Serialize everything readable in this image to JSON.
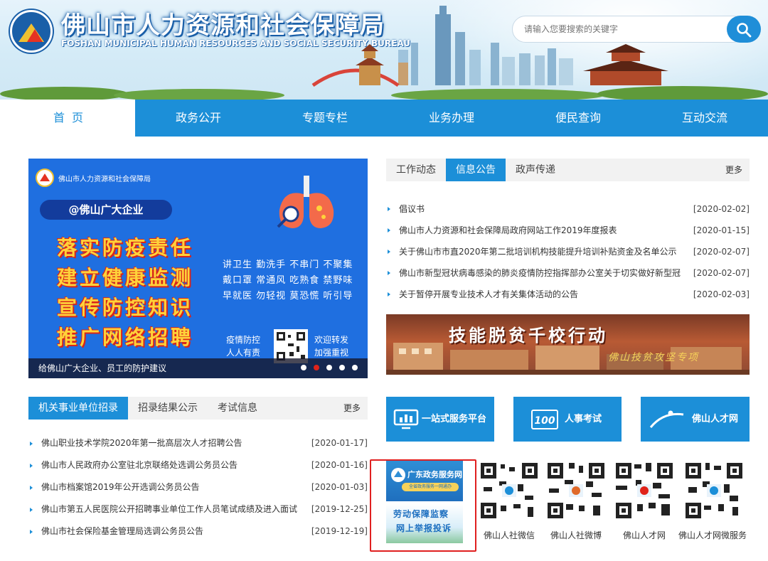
{
  "header": {
    "title_cn": "佛山市人力资源和社会保障局",
    "title_en": "FOSHAN MUNICIPAL HUMAN RESOURCES AND SOCIAL SECURITY BUREAU",
    "search_placeholder": "请输入您要搜索的关键字"
  },
  "nav": [
    {
      "label": "首页"
    },
    {
      "label": "政务公开"
    },
    {
      "label": "专题专栏"
    },
    {
      "label": "业务办理"
    },
    {
      "label": "便民查询"
    },
    {
      "label": "互动交流"
    }
  ],
  "banner": {
    "org": "佛山市人力资源和社会保障局",
    "pill": "@佛山广大企业",
    "lines": [
      "落实防疫责任",
      "建立健康监测",
      "宣传防控知识",
      "推广网络招聘"
    ],
    "side": [
      "讲卫生 勤洗手 不串门 不聚集",
      "戴口罩 常通风 吃熟食 禁野味",
      "早就医 勿轻视 莫恐慌 听引导"
    ],
    "slogan_left": [
      "疫情防控",
      "人人有责"
    ],
    "slogan_right": [
      "欢迎转发",
      "加强重视"
    ],
    "caption": "给佛山广大企业、员工的防护建议"
  },
  "news": {
    "tabs": [
      "工作动态",
      "信息公告",
      "政声传递"
    ],
    "more": "更多",
    "items": [
      {
        "title": "倡议书",
        "date": "[2020-02-02]"
      },
      {
        "title": "佛山市人力资源和社会保障局政府网站工作2019年度报表",
        "date": "[2020-01-15]"
      },
      {
        "title": "关于佛山市市直2020年第二批培训机构技能提升培训补贴资金及名单公示",
        "date": "[2020-02-07]"
      },
      {
        "title": "佛山市新型冠状病毒感染的肺炎疫情防控指挥部办公室关于切实做好新型冠",
        "date": "[2020-02-07]"
      },
      {
        "title": "关于暂停开展专业技术人才有关集体活动的公告",
        "date": "[2020-02-03]"
      }
    ]
  },
  "promo": {
    "title": "技能脱贫千校行动",
    "sub": "佛山技贫攻坚专项"
  },
  "recruit": {
    "tabs": [
      "机关事业单位招录",
      "招录结果公示",
      "考试信息"
    ],
    "more": "更多",
    "items": [
      {
        "title": "佛山职业技术学院2020年第一批高层次人才招聘公告",
        "date": "[2020-01-17]"
      },
      {
        "title": "佛山市人民政府办公室驻北京联络处选调公务员公告",
        "date": "[2020-01-16]"
      },
      {
        "title": "佛山市档案馆2019年公开选调公务员公告",
        "date": "[2020-01-03]"
      },
      {
        "title": "佛山市第五人民医院公开招聘事业单位工作人员笔试成绩及进入面试",
        "date": "[2019-12-25]"
      },
      {
        "title": "佛山市社会保险基金管理局选调公务员公告",
        "date": "[2019-12-19]"
      }
    ]
  },
  "tiles": {
    "service": "一站式服务平台",
    "exam": "人事考试",
    "talent": "佛山人才网"
  },
  "gd_tile": {
    "title": "广东政务服务网",
    "sub": "全省政务服务一网通办"
  },
  "labor_tile": {
    "line1": "劳动保障监察",
    "line2": "网上举报投诉"
  },
  "qr_labels": [
    "佛山人社微信",
    "佛山人社微博",
    "佛山人才网",
    "佛山人才网微服务"
  ],
  "colors": {
    "primary": "#1c8fd8",
    "highlight_box": "#e02020",
    "banner_blue": "#1f6fe0",
    "banner_yellow": "#ffd23a"
  }
}
